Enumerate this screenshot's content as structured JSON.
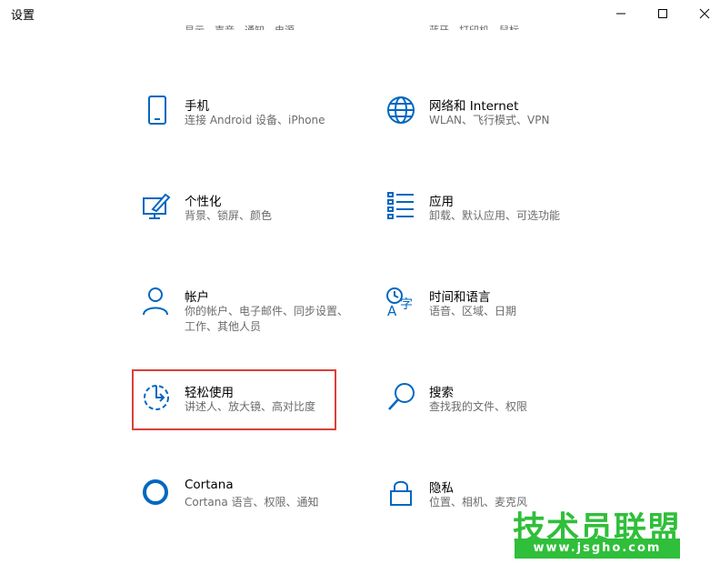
{
  "window": {
    "title": "设置",
    "minimize_icon": "minimize-icon",
    "maximize_icon": "maximize-icon",
    "close_icon": "close-icon"
  },
  "accent_color": "#0067c0",
  "highlight_color": "#d9403a",
  "partial_row": {
    "left_desc": "显示、声音、通知、电源",
    "right_desc": "蓝牙、打印机、鼠标"
  },
  "tiles": [
    {
      "title": "手机",
      "desc": "连接 Android 设备、iPhone",
      "icon": "phone-icon"
    },
    {
      "title": "网络和 Internet",
      "desc": "WLAN、飞行模式、VPN",
      "icon": "globe-icon"
    },
    {
      "title": "个性化",
      "desc": "背景、锁屏、颜色",
      "icon": "personalization-icon"
    },
    {
      "title": "应用",
      "desc": "卸载、默认应用、可选功能",
      "icon": "apps-list-icon"
    },
    {
      "title": "帐户",
      "desc": "你的帐户、电子邮件、同步设置、工作、其他人员",
      "icon": "person-icon"
    },
    {
      "title": "时间和语言",
      "desc": "语音、区域、日期",
      "icon": "time-language-icon"
    },
    {
      "title": "轻松使用",
      "desc": "讲述人、放大镜、高对比度",
      "icon": "ease-of-access-icon"
    },
    {
      "title": "搜索",
      "desc": "查找我的文件、权限",
      "icon": "search-icon"
    },
    {
      "title": "Cortana",
      "desc": "Cortana 语言、权限、通知",
      "icon": "cortana-icon"
    },
    {
      "title": "隐私",
      "desc": "位置、相机、麦克风",
      "icon": "lock-icon"
    }
  ],
  "watermark": {
    "text": "技术员联盟",
    "url": "www.jsgho.com",
    "color": "#2fbf3a"
  }
}
